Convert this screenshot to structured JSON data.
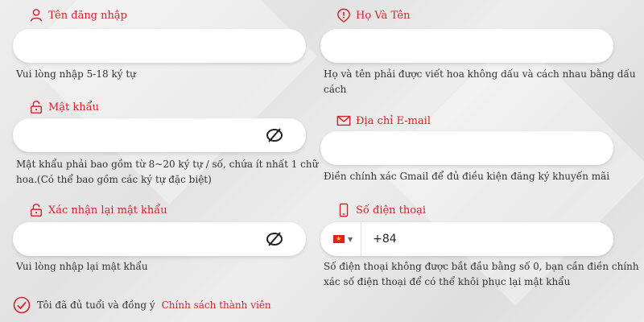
{
  "username": {
    "label": "Tên đăng nhập",
    "value": "",
    "hint": "Vui lòng nhập 5-18 ký tự"
  },
  "fullname": {
    "label": "Họ Và Tên",
    "value": "",
    "hint_line1": "Họ và tên phải được viết hoa không dấu và cách nhau bằng dấu",
    "hint_line2": "cách"
  },
  "password": {
    "label": "Mật khẩu",
    "value": "",
    "hint_line1": "Mật khẩu phải bao gồm từ 8~20 ký tự / số, chứa ít nhất 1 chữ",
    "hint_line2": "hoa.(Có thể bao gồm các ký tự đặc biệt)"
  },
  "email": {
    "label": "Địa chỉ E-mail",
    "value": "",
    "hint": "Điền chính xác Gmail để đủ điều kiện đăng ký khuyến mãi"
  },
  "confirm_password": {
    "label": "Xác nhận lại mật khẩu",
    "value": "",
    "hint": "Vui lòng nhập lại mật khẩu"
  },
  "phone": {
    "label": "Số điện thoại",
    "country_code": "+84",
    "hint_line1": "Số điện thoại không được bắt đầu bằng số 0, bạn cần điền chính",
    "hint_line2": "xác số điện thoại để có thể khôi phục lại mật khẩu"
  },
  "agreement": {
    "text": "Tôi đã đủ tuổi và đồng ý",
    "policy_link": "Chính sách thành viên",
    "checked": true
  },
  "colors": {
    "accent": "#d6242b",
    "hint_text": "#333333",
    "input_bg": "#ffffff"
  },
  "icons": {
    "username": "user-icon",
    "fullname": "info-pin-icon",
    "password": "lock-icon",
    "email": "envelope-icon",
    "confirm_password": "lock-icon",
    "phone": "mobile-phone-icon",
    "visibility": "eye-off-icon",
    "agreement": "check-circle-icon"
  }
}
